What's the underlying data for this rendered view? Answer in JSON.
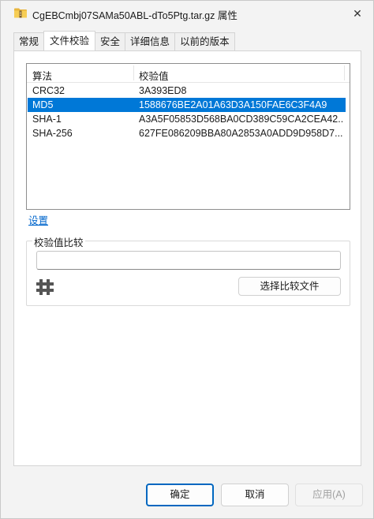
{
  "window": {
    "title": "CgEBCmbj07SAMa50ABL-dTo5Ptg.tar.gz 属性",
    "close_glyph": "✕",
    "title_icon": "folder-archive-icon"
  },
  "tabs": [
    {
      "label": "常规"
    },
    {
      "label": "文件校验"
    },
    {
      "label": "安全"
    },
    {
      "label": "详细信息"
    },
    {
      "label": "以前的版本"
    }
  ],
  "hash_list": {
    "columns": {
      "algorithm": "算法",
      "value": "校验值"
    },
    "rows": [
      {
        "algorithm": "CRC32",
        "value": "3A393ED8"
      },
      {
        "algorithm": "MD5",
        "value": "1588676BE2A01A63D3A150FAE6C3F4A9"
      },
      {
        "algorithm": "SHA-1",
        "value": "A3A5F05853D568BA0CD389C59CA2CEA42..."
      },
      {
        "algorithm": "SHA-256",
        "value": "627FE086209BBA80A2853A0ADD9D958D7..."
      }
    ],
    "selected_index": 1
  },
  "settings_link": "设置",
  "compare": {
    "group_title": "校验值比较",
    "input_value": "",
    "select_file_label": "选择比较文件",
    "hash_icon": "hash-icon"
  },
  "buttons": {
    "ok": "确定",
    "cancel": "取消",
    "apply": "应用(A)"
  },
  "colors": {
    "selection": "#0078d7",
    "link": "#0066cc",
    "primary_border": "#0067c0"
  }
}
